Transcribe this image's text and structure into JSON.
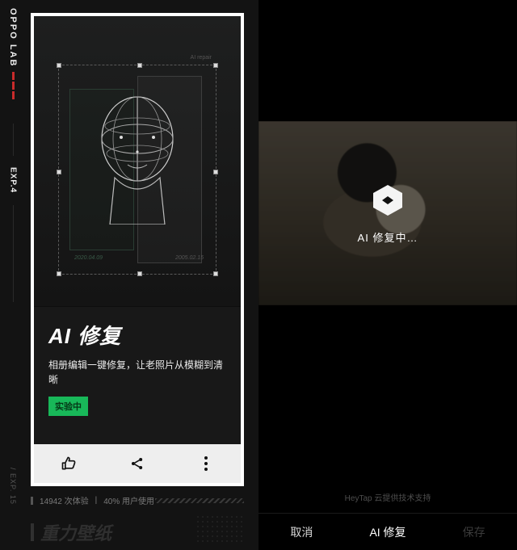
{
  "leftPanel": {
    "brand": "OPPO LAB",
    "expTag": "EXP.4",
    "expSide": "/ EXP. 15",
    "illustration": {
      "labelTopRight": "AI repair",
      "dateLeft": "2020.04.09",
      "dateRight": "2005.02.15"
    },
    "title": "AI 修复",
    "description": "相册编辑一键修复，让老照片从模糊到清晰",
    "badge": "实验中",
    "stats": {
      "trials": "14942 次体验",
      "sep": "|",
      "usage": "40% 用户使用"
    },
    "nextTitle": "重力壁纸"
  },
  "rightPanel": {
    "loadingText": "AI 修复中…",
    "provider": "HeyTap 云提供技术支持",
    "bottomBar": {
      "cancel": "取消",
      "action": "AI 修复",
      "save": "保存"
    }
  }
}
